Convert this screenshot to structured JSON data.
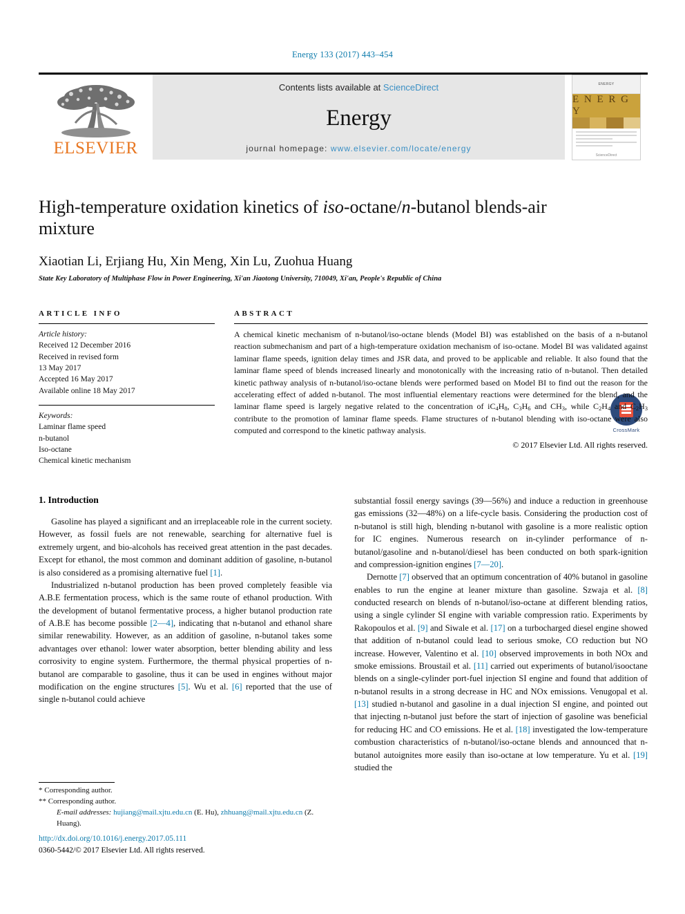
{
  "running_head": "Energy 133 (2017) 443–454",
  "masthead": {
    "publisher_name": "ELSEVIER",
    "contents_prefix": "Contents lists available at ",
    "contents_link": "ScienceDirect",
    "journal_name": "Energy",
    "homepage_prefix": "journal homepage: ",
    "homepage_url": "www.elsevier.com/locate/energy",
    "cover": {
      "top_label": "ENERGY",
      "band_label": "E N E R G Y",
      "foot_label": "ScienceDirect"
    }
  },
  "article": {
    "title_part1": "High-temperature oxidation kinetics of ",
    "title_iso": "iso",
    "title_part2": "-octane/",
    "title_n": "n",
    "title_part3": "-butanol blends-air mixture",
    "authors": "Xiaotian Li, Erjiang Hu, Xin Meng, Xin Lu, Zuohua Huang",
    "author_mark_1": "*",
    "author_mark_2": "**",
    "affiliation": "State Key Laboratory of Multiphase Flow in Power Engineering, Xi'an Jiaotong University, 710049, Xi'an, People's Republic of China",
    "crossmark_label": "CrossMark"
  },
  "article_info": {
    "heading": "ARTICLE INFO",
    "history_label": "Article history:",
    "history": [
      "Received 12 December 2016",
      "Received in revised form",
      "13 May 2017",
      "Accepted 16 May 2017",
      "Available online 18 May 2017"
    ],
    "keywords_label": "Keywords:",
    "keywords": [
      "Laminar flame speed",
      "n-butanol",
      "Iso-octane",
      "Chemical kinetic mechanism"
    ]
  },
  "abstract": {
    "heading": "ABSTRACT",
    "p1": "A chemical kinetic mechanism of n-butanol/iso-octane blends (Model BI) was established on the basis of a n-butanol reaction submechanism and part of a high-temperature oxidation mechanism of iso-octane. Model BI was validated against laminar flame speeds, ignition delay times and JSR data, and proved to be applicable and reliable. It also found that the laminar flame speed of blends increased linearly and monotonically with the increasing ratio of n-butanol. Then detailed kinetic pathway analysis of n-butanol/iso-octane blends were performed based on Model BI to find out the reason for the accelerating effect of added n-butanol. The most influential elementary reactions were determined for the blend, and the laminar flame speed is largely negative related to the concentration of ",
    "f1": "iC4H8",
    "p2": ", ",
    "f2": "C3H6",
    "p3": " and ",
    "f3": "CH3",
    "p4": ", while ",
    "f4": "C2H4",
    "p5": " and ",
    "f5": "C2H3",
    "p6": " contribute to the promotion of laminar flame speeds. Flame structures of n-butanol blending with iso-octane were also computed and correspond to the kinetic pathway analysis.",
    "copyright": "© 2017 Elsevier Ltd. All rights reserved."
  },
  "intro": {
    "heading": "1. Introduction",
    "left_p1_a": "Gasoline has played a significant and an irreplaceable role in the current society. However, as fossil fuels are not renewable, searching for alternative fuel is extremely urgent, and bio-alcohols has received great attention in the past decades. Except for ethanol, the most common and dominant addition of gasoline, n-butanol is also considered as a promising alternative fuel ",
    "left_p1_ref": "[1]",
    "left_p1_b": ".",
    "left_p2_a": "Industrialized n-butanol production has been proved completely feasible via A.B.E fermentation process, which is the same route of ethanol production. With the development of butanol fermentative process, a higher butanol production rate of A.B.E has become possible ",
    "left_p2_ref1": "[2—4]",
    "left_p2_b": ", indicating that n-butanol and ethanol share similar renewability. However, as an addition of gasoline, n-butanol takes some advantages over ethanol: lower water absorption, better blending ability and less corrosivity to engine system. Furthermore, the thermal physical properties of n-butanol are comparable to gasoline, thus it can be used in engines without major modification on the engine structures ",
    "left_p2_ref2": "[5]",
    "left_p2_c": ". Wu et al. ",
    "left_p2_ref3": "[6]",
    "left_p2_d": " reported that the use of single n-butanol could achieve",
    "right_p1_a": "substantial fossil energy savings (39—56%) and induce a reduction in greenhouse gas emissions (32—48%) on a life-cycle basis. Considering the production cost of n-butanol is still high, blending n-butanol with gasoline is a more realistic option for IC engines. Numerous research on in-cylinder performance of n-butanol/gasoline and n-butanol/diesel has been conducted on both spark-ignition and compression-ignition engines ",
    "right_p1_ref": "[7—20]",
    "right_p1_b": ".",
    "right_p2_a": "Dernotte ",
    "right_p2_ref1": "[7]",
    "right_p2_b": " observed that an optimum concentration of 40% butanol in gasoline enables to run the engine at leaner mixture than gasoline. Szwaja et al. ",
    "right_p2_ref2": "[8]",
    "right_p2_c": " conducted research on blends of n-butanol/iso-octane at different blending ratios, using a single cylinder SI engine with variable compression ratio. Experiments by Rakopoulos et al. ",
    "right_p2_ref3": "[9]",
    "right_p2_d": " and Siwale et al. ",
    "right_p2_ref4": "[17]",
    "right_p2_e": " on a turbocharged diesel engine showed that addition of n-butanol could lead to serious smoke, CO reduction but NO increase. However, Valentino et al. ",
    "right_p2_ref5": "[10]",
    "right_p2_f": " observed improvements in both NOx and smoke emissions. Broustail et al. ",
    "right_p2_ref6": "[11]",
    "right_p2_g": " carried out experiments of butanol/isooctane blends on a single-cylinder port-fuel injection SI engine and found that addition of n-butanol results in a strong decrease in HC and NOx emissions. Venugopal et al. ",
    "right_p2_ref7": "[13]",
    "right_p2_h": " studied n-butanol and gasoline in a dual injection SI engine, and pointed out that injecting n-butanol just before the start of injection of gasoline was beneficial for reducing HC and CO emissions. He et al. ",
    "right_p2_ref8": "[18]",
    "right_p2_i": " investigated the low-temperature combustion characteristics of n-butanol/iso-octane blends and announced that n-butanol autoignites more easily than iso-octane at low temperature. Yu et al. ",
    "right_p2_ref9": "[19]",
    "right_p2_j": " studied the"
  },
  "footnotes": {
    "mark1": "*",
    "corresponding1": "Corresponding author.",
    "mark2": "**",
    "corresponding2": "Corresponding author.",
    "email_label": "E-mail addresses:",
    "email1": "hujiang@mail.xjtu.edu.cn",
    "email1_who": "(E. Hu),",
    "email2": "zhhuang@mail.xjtu.edu.cn",
    "email2_who": "(Z. Huang)."
  },
  "footer": {
    "doi": "http://dx.doi.org/10.1016/j.energy.2017.05.111",
    "issn_line": "0360-5442/© 2017 Elsevier Ltd. All rights reserved."
  },
  "colors": {
    "link": "#0b7aab",
    "elsevier_orange": "#E87722",
    "masthead_bg": "#e6e6e6"
  }
}
